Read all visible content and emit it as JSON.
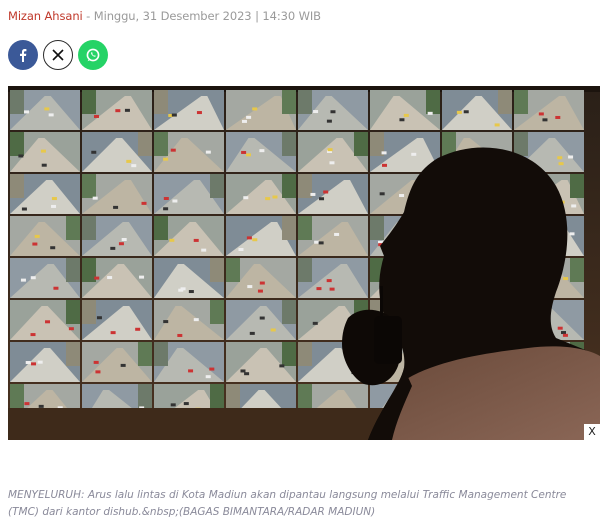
{
  "byline": {
    "author": "Mizan Ahsani",
    "separator": " - ",
    "datetime": "Minggu, 31 Desember 2023 | 14:30 WIB"
  },
  "share": {
    "facebook_icon": "facebook-icon",
    "x_icon": "x-icon",
    "whatsapp_icon": "whatsapp-icon",
    "facebook_color": "#3b5998",
    "whatsapp_color": "#25d366"
  },
  "photo": {
    "close_label": "X",
    "cctv_wall_rows": 8,
    "cctv_wall_cols": 8
  },
  "caption": {
    "text": "MENYELURUH: Arus lalu lintas di Kota Madiun akan dipantau langsung melalui Traffic Management Centre (TMC) dari kantor dishub.&nbsp;(BAGAS BIMANTARA/RADAR MADIUN)"
  }
}
